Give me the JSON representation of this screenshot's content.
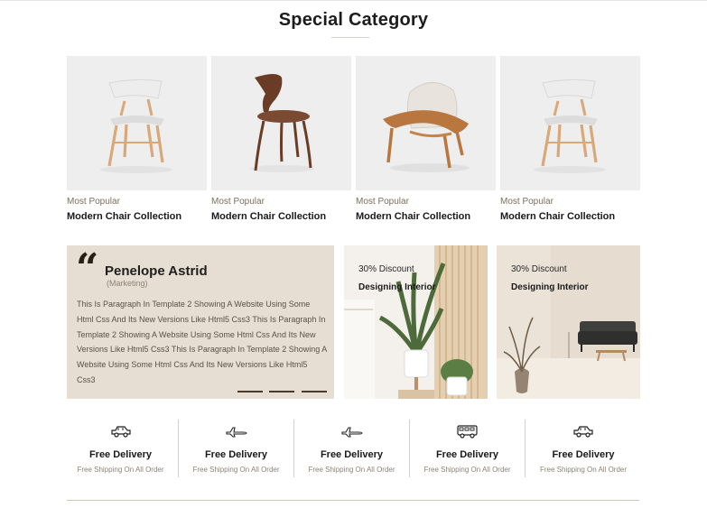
{
  "section": {
    "title": "Special Category"
  },
  "cards": [
    {
      "subtitle": "Most Popular",
      "title": "Modern Chair Collection",
      "image": "white-chair-image"
    },
    {
      "subtitle": "Most Popular",
      "title": "Modern Chair Collection",
      "image": "walnut-chair-image"
    },
    {
      "subtitle": "Most Popular",
      "title": "Modern Chair Collection",
      "image": "lounge-chair-image"
    },
    {
      "subtitle": "Most Popular",
      "title": "Modern Chair Collection",
      "image": "white-chair-image"
    }
  ],
  "testimonial": {
    "name": "Penelope Astrid",
    "role": "(Marketing)",
    "text": "This Is Paragraph In Template 2 Showing A Website Using Some Html Css And Its New Versions Like Html5 Css3 This Is Paragraph In Template 2 Showing A Website Using Some Html Css And Its New Versions Like Html5 Css3 This Is Paragraph In Template 2 Showing A Website Using Some Html Css And Its New Versions Like Html5 Css3"
  },
  "promos": [
    {
      "discount": "30% Discount",
      "title": "Designing Interior"
    },
    {
      "discount": "30% Discount",
      "title": "Designing Interior"
    }
  ],
  "features": [
    {
      "title": "Free Delivery",
      "subtitle": "Free Shipping On All Order",
      "icon": "car-icon"
    },
    {
      "title": "Free Delivery",
      "subtitle": "Free Shipping On All Order",
      "icon": "airplane-icon"
    },
    {
      "title": "Free Delivery",
      "subtitle": "Free Shipping On All Order",
      "icon": "airplane-icon"
    },
    {
      "title": "Free Delivery",
      "subtitle": "Free Shipping On All Order",
      "icon": "bus-icon"
    },
    {
      "title": "Free Delivery",
      "subtitle": "Free Shipping On All Order",
      "icon": "car-icon"
    }
  ],
  "colors": {
    "accent": "#7c6f5c",
    "testimonial_bg": "#e6ded2",
    "card_bg": "#eeeeee"
  }
}
